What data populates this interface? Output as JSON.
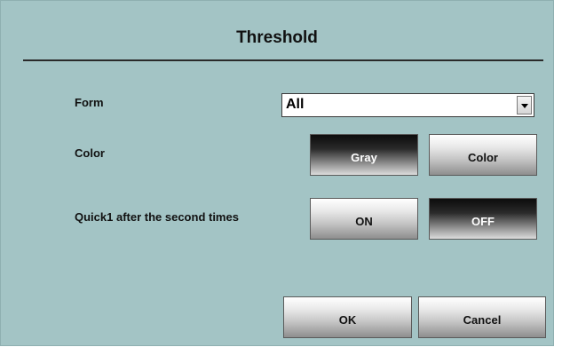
{
  "dialog": {
    "title": "Threshold"
  },
  "form": {
    "label": "Form",
    "selected": "All"
  },
  "color": {
    "label": "Color",
    "options": [
      {
        "label": "Gray",
        "selected": true
      },
      {
        "label": "Color",
        "selected": false
      }
    ]
  },
  "quick": {
    "label": "Quick1 after the second times",
    "options": [
      {
        "label": "ON",
        "selected": false
      },
      {
        "label": "OFF",
        "selected": true
      }
    ]
  },
  "footer": {
    "ok_label": "OK",
    "cancel_label": "Cancel"
  },
  "colors": {
    "background": "#a3c4c5",
    "selected_button": "#1a1a1a",
    "unselected_button": "#d0d0d0"
  }
}
